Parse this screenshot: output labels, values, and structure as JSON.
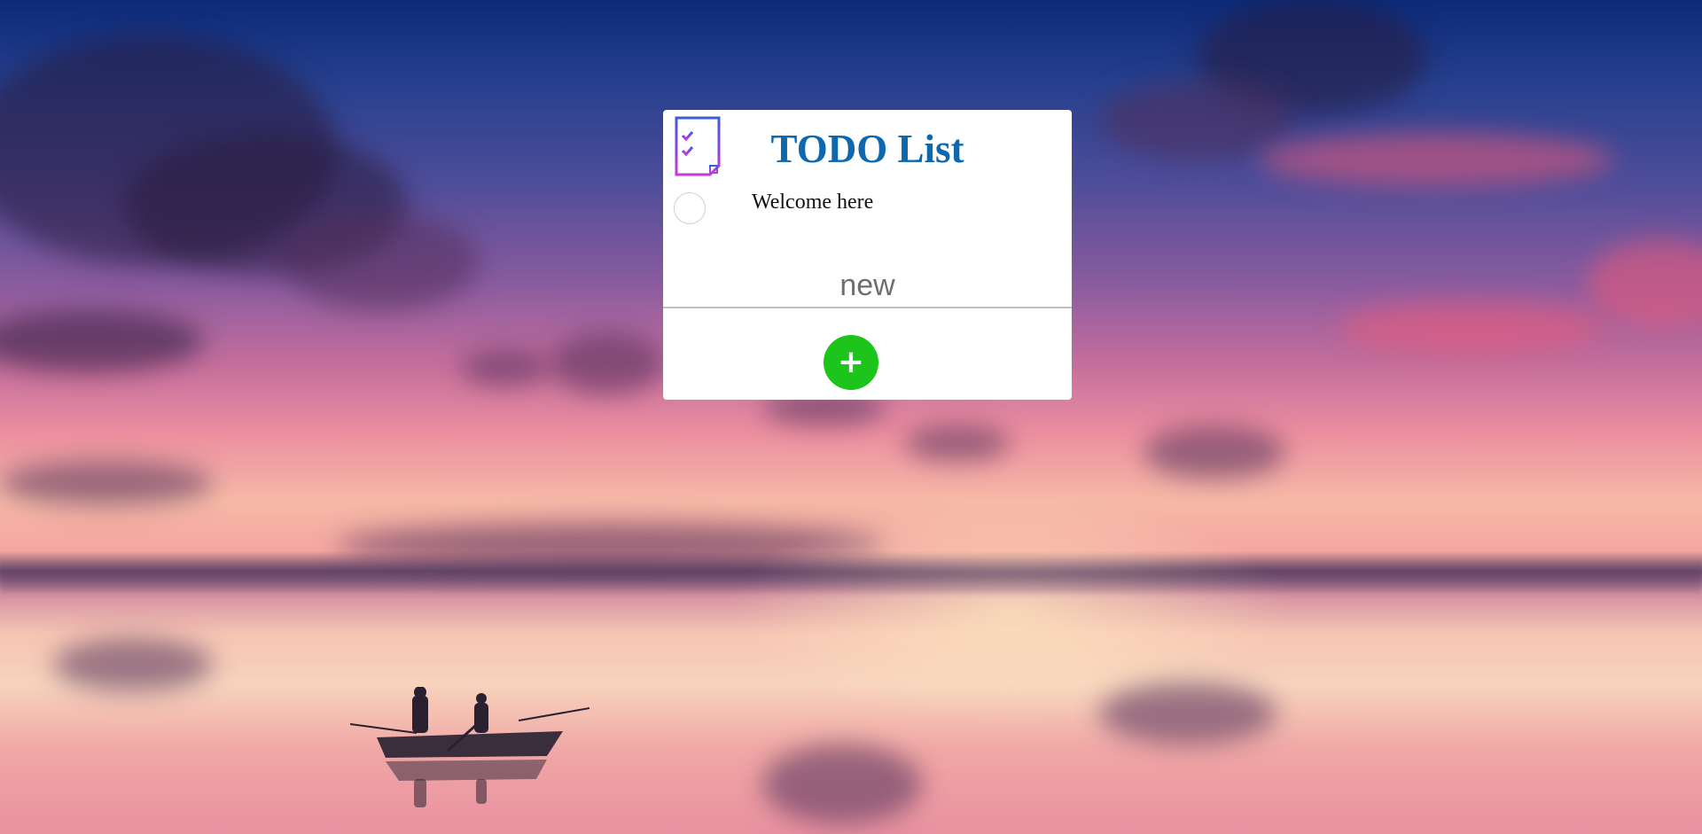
{
  "app": {
    "title": "TODO List",
    "logo_icon": "checklist-icon",
    "title_color": "#0e68ad"
  },
  "todos": [
    {
      "text": "Welcome here",
      "done": false
    }
  ],
  "new_item": {
    "placeholder": "new",
    "value": ""
  },
  "add_button": {
    "label": "+",
    "icon": "plus-icon",
    "color": "#1cc41c"
  },
  "background": {
    "image": "sunset-lake-with-fishing-boat"
  }
}
